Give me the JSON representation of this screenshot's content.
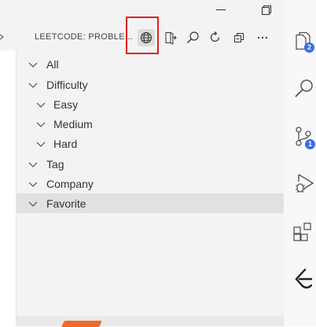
{
  "window": {
    "minimize_icon": "minimize-icon",
    "restore_icon": "restore-icon",
    "close_icon": "close-icon"
  },
  "view": {
    "title": "LEETCODE: PROBLE...",
    "actions": [
      {
        "icon": "globe-icon",
        "active": true
      },
      {
        "icon": "sign-out-icon"
      },
      {
        "icon": "search-icon"
      },
      {
        "icon": "refresh-icon"
      },
      {
        "icon": "collapse-all-icon"
      },
      {
        "icon": "more-icon"
      }
    ]
  },
  "tree": {
    "all": "All",
    "difficulty": "Difficulty",
    "easy": "Easy",
    "medium": "Medium",
    "hard": "Hard",
    "tag": "Tag",
    "company": "Company",
    "favorite": "Favorite"
  },
  "activity_bar": {
    "explorer_badge": "2",
    "scm_badge": "1",
    "badge_color": "#3a6ce6"
  },
  "colors": {
    "highlight": "#e0201e",
    "selected_row": "#e1e1e1"
  }
}
